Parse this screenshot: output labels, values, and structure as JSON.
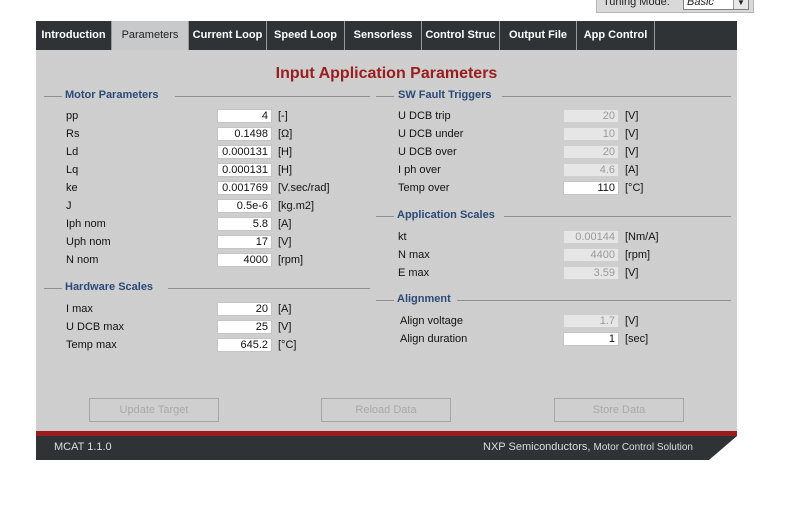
{
  "tuning": {
    "label": "Tuning Mode:",
    "value": "Basic"
  },
  "tabs": [
    {
      "label": "Introduction"
    },
    {
      "label": "Parameters"
    },
    {
      "label": "Current Loop"
    },
    {
      "label": "Speed Loop"
    },
    {
      "label": "Sensorless"
    },
    {
      "label": "Control Struc"
    },
    {
      "label": "Output File"
    },
    {
      "label": "App Control"
    }
  ],
  "title": "Input Application Parameters",
  "motor": {
    "label": "Motor Parameters",
    "rows": [
      {
        "label": "pp",
        "value": "4",
        "unit": "[-]"
      },
      {
        "label": "Rs",
        "value": "0.1498",
        "unit": "[Ω]"
      },
      {
        "label": "Ld",
        "value": "0.000131",
        "unit": "[H]"
      },
      {
        "label": "Lq",
        "value": "0.000131",
        "unit": "[H]"
      },
      {
        "label": "ke",
        "value": "0.001769",
        "unit": "[V.sec/rad]"
      },
      {
        "label": "J",
        "value": "0.5e-6",
        "unit": "[kg.m2]"
      },
      {
        "label": "Iph nom",
        "value": "5.8",
        "unit": "[A]"
      },
      {
        "label": "Uph nom",
        "value": "17",
        "unit": "[V]"
      },
      {
        "label": "N nom",
        "value": "4000",
        "unit": "[rpm]"
      }
    ]
  },
  "hardware": {
    "label": "Hardware Scales",
    "rows": [
      {
        "label": "I max",
        "value": "20",
        "unit": "[A]"
      },
      {
        "label": "U DCB max",
        "value": "25",
        "unit": "[V]"
      },
      {
        "label": "Temp max",
        "value": "645.2",
        "unit": "[°C]"
      }
    ]
  },
  "fault": {
    "label": "SW Fault Triggers",
    "rows": [
      {
        "label": "U DCB trip",
        "value": "20",
        "unit": "[V]"
      },
      {
        "label": "U DCB under",
        "value": "10",
        "unit": "[V]"
      },
      {
        "label": "U DCB over",
        "value": "20",
        "unit": "[V]"
      },
      {
        "label": "I ph over",
        "value": "4.6",
        "unit": "[A]"
      },
      {
        "label": "Temp over",
        "value": "110",
        "unit": "[°C]"
      }
    ]
  },
  "appscales": {
    "label": "Application Scales",
    "rows": [
      {
        "label": "kt",
        "value": "0.00144",
        "unit": "[Nm/A]"
      },
      {
        "label": "N max",
        "value": "4400",
        "unit": "[rpm]"
      },
      {
        "label": "E max",
        "value": "3.59",
        "unit": "[V]"
      }
    ]
  },
  "alignment": {
    "label": "Alignment",
    "rows": [
      {
        "label": "Align voltage",
        "value": "1.7",
        "unit": "[V]"
      },
      {
        "label": "Align duration",
        "value": "1",
        "unit": "[sec]"
      }
    ]
  },
  "buttons": {
    "update": "Update Target",
    "reload": "Reload Data",
    "store": "Store Data"
  },
  "footer": {
    "version": "MCAT 1.1.0",
    "company": "NXP Semiconductors,",
    "solution": "Motor Control Solution"
  },
  "colors": {
    "title": "#9b1c1c",
    "group_label": "#2a4a78",
    "tab_bar": "#2f3336",
    "footer_accent": "#9b1c1c"
  }
}
